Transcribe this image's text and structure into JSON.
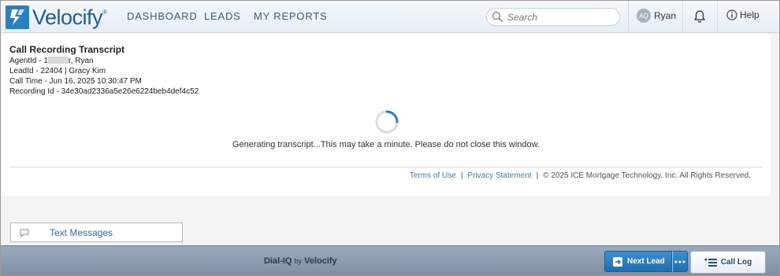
{
  "app": {
    "brand": "Velocify",
    "nav": [
      "DASHBOARD",
      "LEADS",
      "MY REPORTS"
    ],
    "search_placeholder": "Search",
    "user_initials": "AQ",
    "user_name": "Ryan",
    "help_label": "Help"
  },
  "transcript": {
    "title": "Call Recording Transcript",
    "agent_prefix": "AgentId - 1",
    "agent_suffix": "r, Ryan",
    "lead": "LeadId - 22404 | Gracy Kim",
    "call_time": "Call Time - Jun 16, 2025 10:30:47 PM",
    "recording_id": "Recording Id - 34e30ad2336a5e26e6224beb4def4c52",
    "status": "Generating transcript...This may take a minute. Please do not close this window."
  },
  "footer": {
    "terms": "Terms of Use",
    "sep1": "|",
    "privacy": "Privacy Statement",
    "sep2": "|",
    "copyright": "© 2025 ICE Mortgage Technology, Inc. All Rights Reserved."
  },
  "text_messages_label": "Text Messages",
  "bottom": {
    "brand_dial": "Dial-IQ",
    "brand_by": "by",
    "brand_velocify": "Velocify",
    "next_lead": "Next Lead",
    "call_log": "Call Log"
  }
}
